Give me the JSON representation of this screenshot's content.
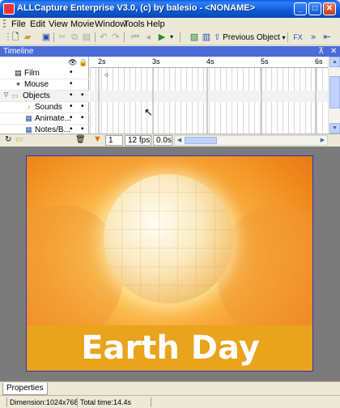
{
  "window": {
    "title": "ALLCapture Enterprise V3.0, (c) by balesio - <NONAME>",
    "minimize": "_",
    "maximize": "□",
    "close": "✕"
  },
  "menu": [
    "File",
    "Edit",
    "View",
    "Movie",
    "Window",
    "Tools",
    "Help"
  ],
  "toolbar": {
    "previous_object_label": "Previous Object"
  },
  "timeline": {
    "title": "Timeline",
    "pin": "⊼",
    "close": "✕",
    "ruler_ticks": [
      "2s",
      "3s",
      "4s",
      "5s",
      "6s"
    ],
    "layers": [
      {
        "label": "Film",
        "icon": "film-icon",
        "glyph": "▤"
      },
      {
        "label": "Mouse",
        "icon": "mouse-icon",
        "glyph": "⌖"
      },
      {
        "label": "Objects",
        "icon": "folder-icon",
        "glyph": "▭"
      },
      {
        "label": "Sounds",
        "icon": "sound-icon",
        "glyph": "♪"
      },
      {
        "label": "Animate...",
        "icon": "animate-icon",
        "glyph": "▦"
      },
      {
        "label": "Notes/B...",
        "icon": "notes-icon",
        "glyph": "▦"
      }
    ],
    "current_frame": "1",
    "fps": "12 fps",
    "time": "0.0s"
  },
  "slide": {
    "banner_text": "Earth Day"
  },
  "properties_tab": "Properties",
  "status": {
    "dimension": "Dimension:1024x768",
    "total_time": "Total time:14.4s"
  }
}
